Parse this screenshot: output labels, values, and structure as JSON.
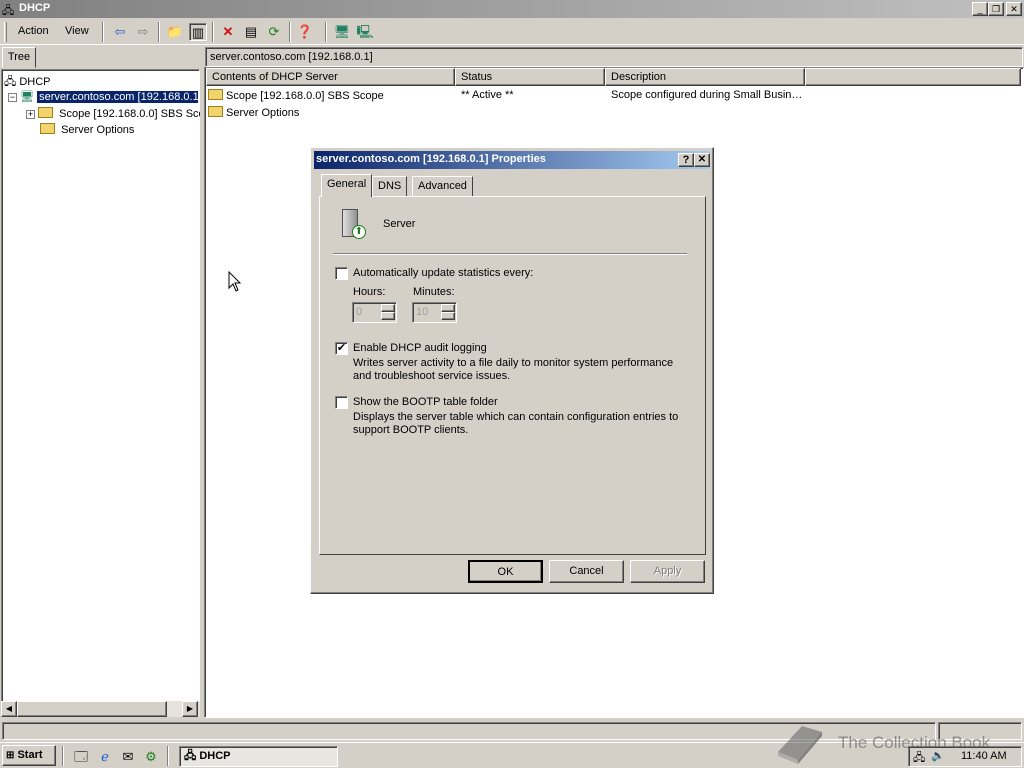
{
  "window": {
    "title": "DHCP"
  },
  "menu": {
    "action": "Action",
    "view": "View"
  },
  "tree": {
    "tab_label": "Tree",
    "root": "DHCP",
    "server": "server.contoso.com [192.168.0.1]",
    "scope": "Scope [192.168.0.0] SBS Scope",
    "server_options": "Server Options"
  },
  "right_pane": {
    "header": "server.contoso.com [192.168.0.1]",
    "columns": [
      "Contents of DHCP Server",
      "Status",
      "Description"
    ],
    "rows": [
      {
        "name": "Scope [192.168.0.0] SBS Scope",
        "status": "** Active **",
        "description": "Scope configured during Small Busin…"
      },
      {
        "name": "Server Options",
        "status": "",
        "description": ""
      }
    ]
  },
  "dialog": {
    "title": "server.contoso.com [192.168.0.1] Properties",
    "help": "?",
    "tabs": [
      "General",
      "DNS",
      "Advanced"
    ],
    "server_label": "Server",
    "auto_update_label": "Automatically update statistics every:",
    "auto_update_checked": false,
    "hours_label": "Hours:",
    "hours_value": "0",
    "minutes_label": "Minutes:",
    "minutes_value": "10",
    "audit_label": "Enable DHCP audit logging",
    "audit_checked": true,
    "audit_desc": "Writes server activity to a file daily to monitor system performance and troubleshoot service issues.",
    "bootp_label": "Show the BOOTP table folder",
    "bootp_checked": false,
    "bootp_desc": "Displays the server table which can contain configuration entries to support BOOTP clients.",
    "ok": "OK",
    "cancel": "Cancel",
    "apply": "Apply"
  },
  "taskbar": {
    "start": "Start",
    "task": "DHCP",
    "clock": "11:40 AM"
  },
  "watermark": "The Collection Book",
  "colors": {
    "title_gradient_start": "#0a246a",
    "title_gradient_end": "#a6caf0",
    "face": "#d4d0c8"
  }
}
